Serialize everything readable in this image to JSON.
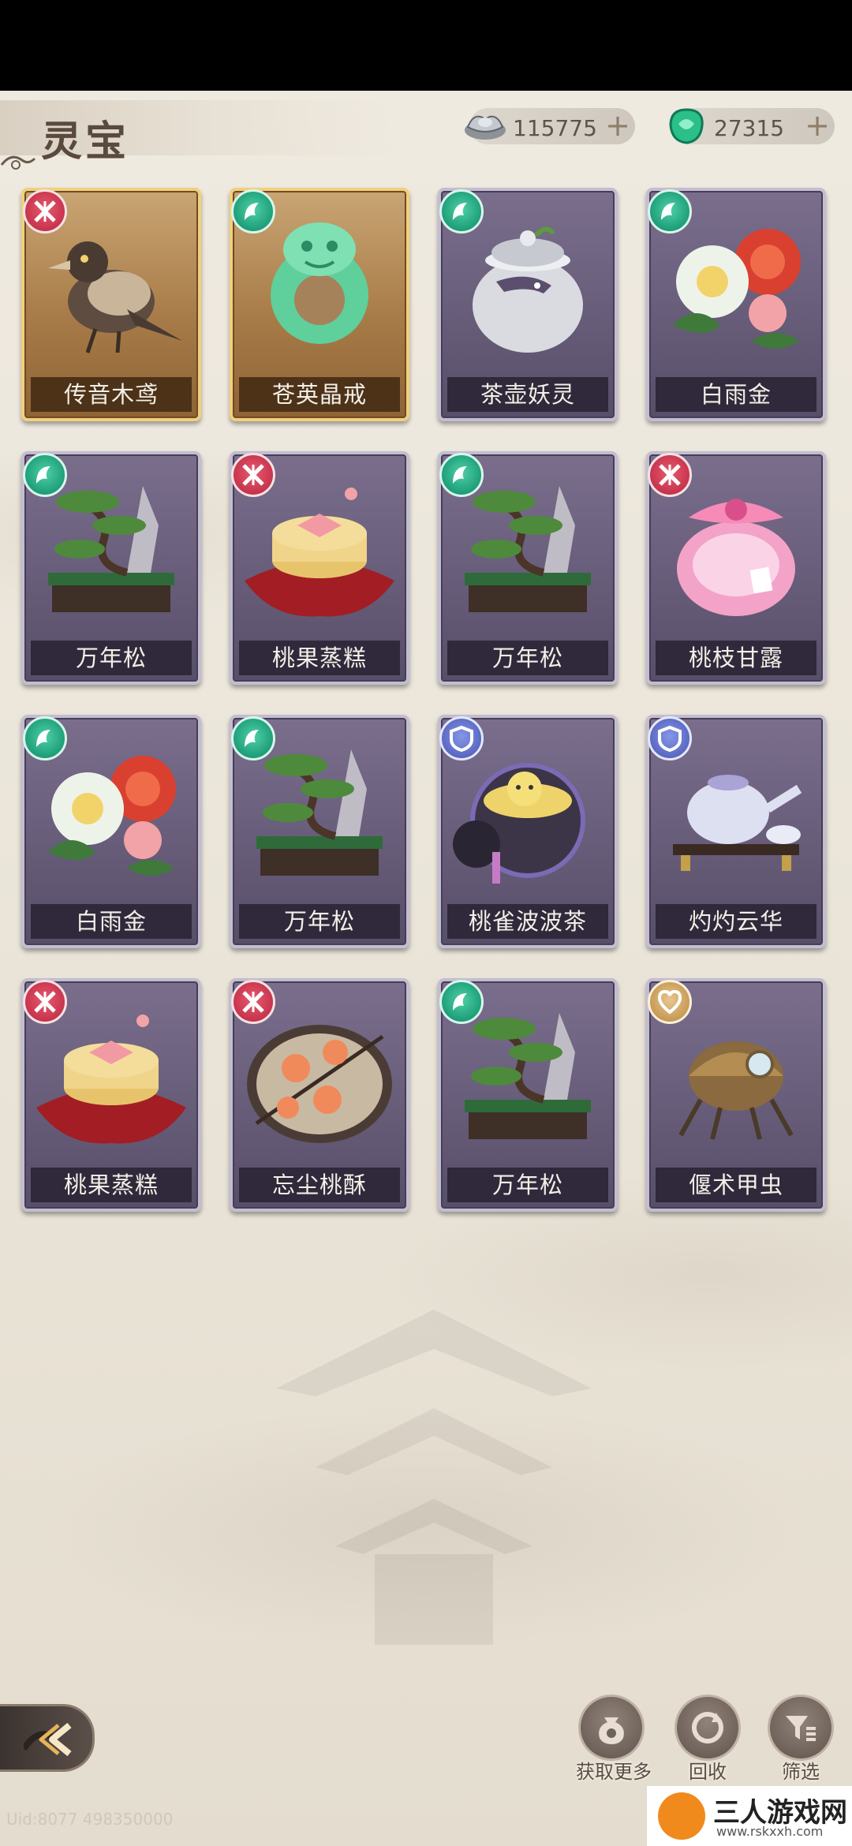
{
  "header": {
    "title": "灵宝",
    "currency": [
      {
        "icon": "silver-ingot-icon",
        "value": "115775"
      },
      {
        "icon": "jade-gem-icon",
        "value": "27315"
      }
    ]
  },
  "items": [
    {
      "name": "传音木鸢",
      "badge": "red",
      "frame": "gold",
      "art": "bird"
    },
    {
      "name": "苍英晶戒",
      "badge": "green",
      "frame": "gold",
      "art": "ring"
    },
    {
      "name": "茶壶妖灵",
      "badge": "green",
      "frame": "purple",
      "art": "teapot-jar"
    },
    {
      "name": "白雨金",
      "badge": "green",
      "frame": "purple",
      "art": "flowers"
    },
    {
      "name": "万年松",
      "badge": "green",
      "frame": "purple",
      "art": "bonsai"
    },
    {
      "name": "桃果蒸糕",
      "badge": "red",
      "frame": "purple",
      "art": "steamer"
    },
    {
      "name": "万年松",
      "badge": "green",
      "frame": "purple",
      "art": "bonsai"
    },
    {
      "name": "桃枝甘露",
      "badge": "red",
      "frame": "purple",
      "art": "pink-jar"
    },
    {
      "name": "白雨金",
      "badge": "green",
      "frame": "purple",
      "art": "flowers"
    },
    {
      "name": "万年松",
      "badge": "green",
      "frame": "purple",
      "art": "bonsai"
    },
    {
      "name": "桃雀波波茶",
      "badge": "blue",
      "frame": "purple",
      "art": "tea-bowl"
    },
    {
      "name": "灼灼云华",
      "badge": "blue",
      "frame": "purple",
      "art": "teaset"
    },
    {
      "name": "桃果蒸糕",
      "badge": "red",
      "frame": "purple",
      "art": "steamer"
    },
    {
      "name": "忘尘桃酥",
      "badge": "red",
      "frame": "purple",
      "art": "peach-plate"
    },
    {
      "name": "万年松",
      "badge": "green",
      "frame": "purple",
      "art": "bonsai"
    },
    {
      "name": "偃术甲虫",
      "badge": "gold",
      "frame": "purple",
      "art": "beetle"
    }
  ],
  "actions": {
    "more": "获取更多",
    "recycle": "回收",
    "filter": "筛选"
  },
  "footer": {
    "uid": "Uid:8077 498350000",
    "watermark_title": "三人游戏网",
    "watermark_url": "www.rskxxh.com"
  }
}
